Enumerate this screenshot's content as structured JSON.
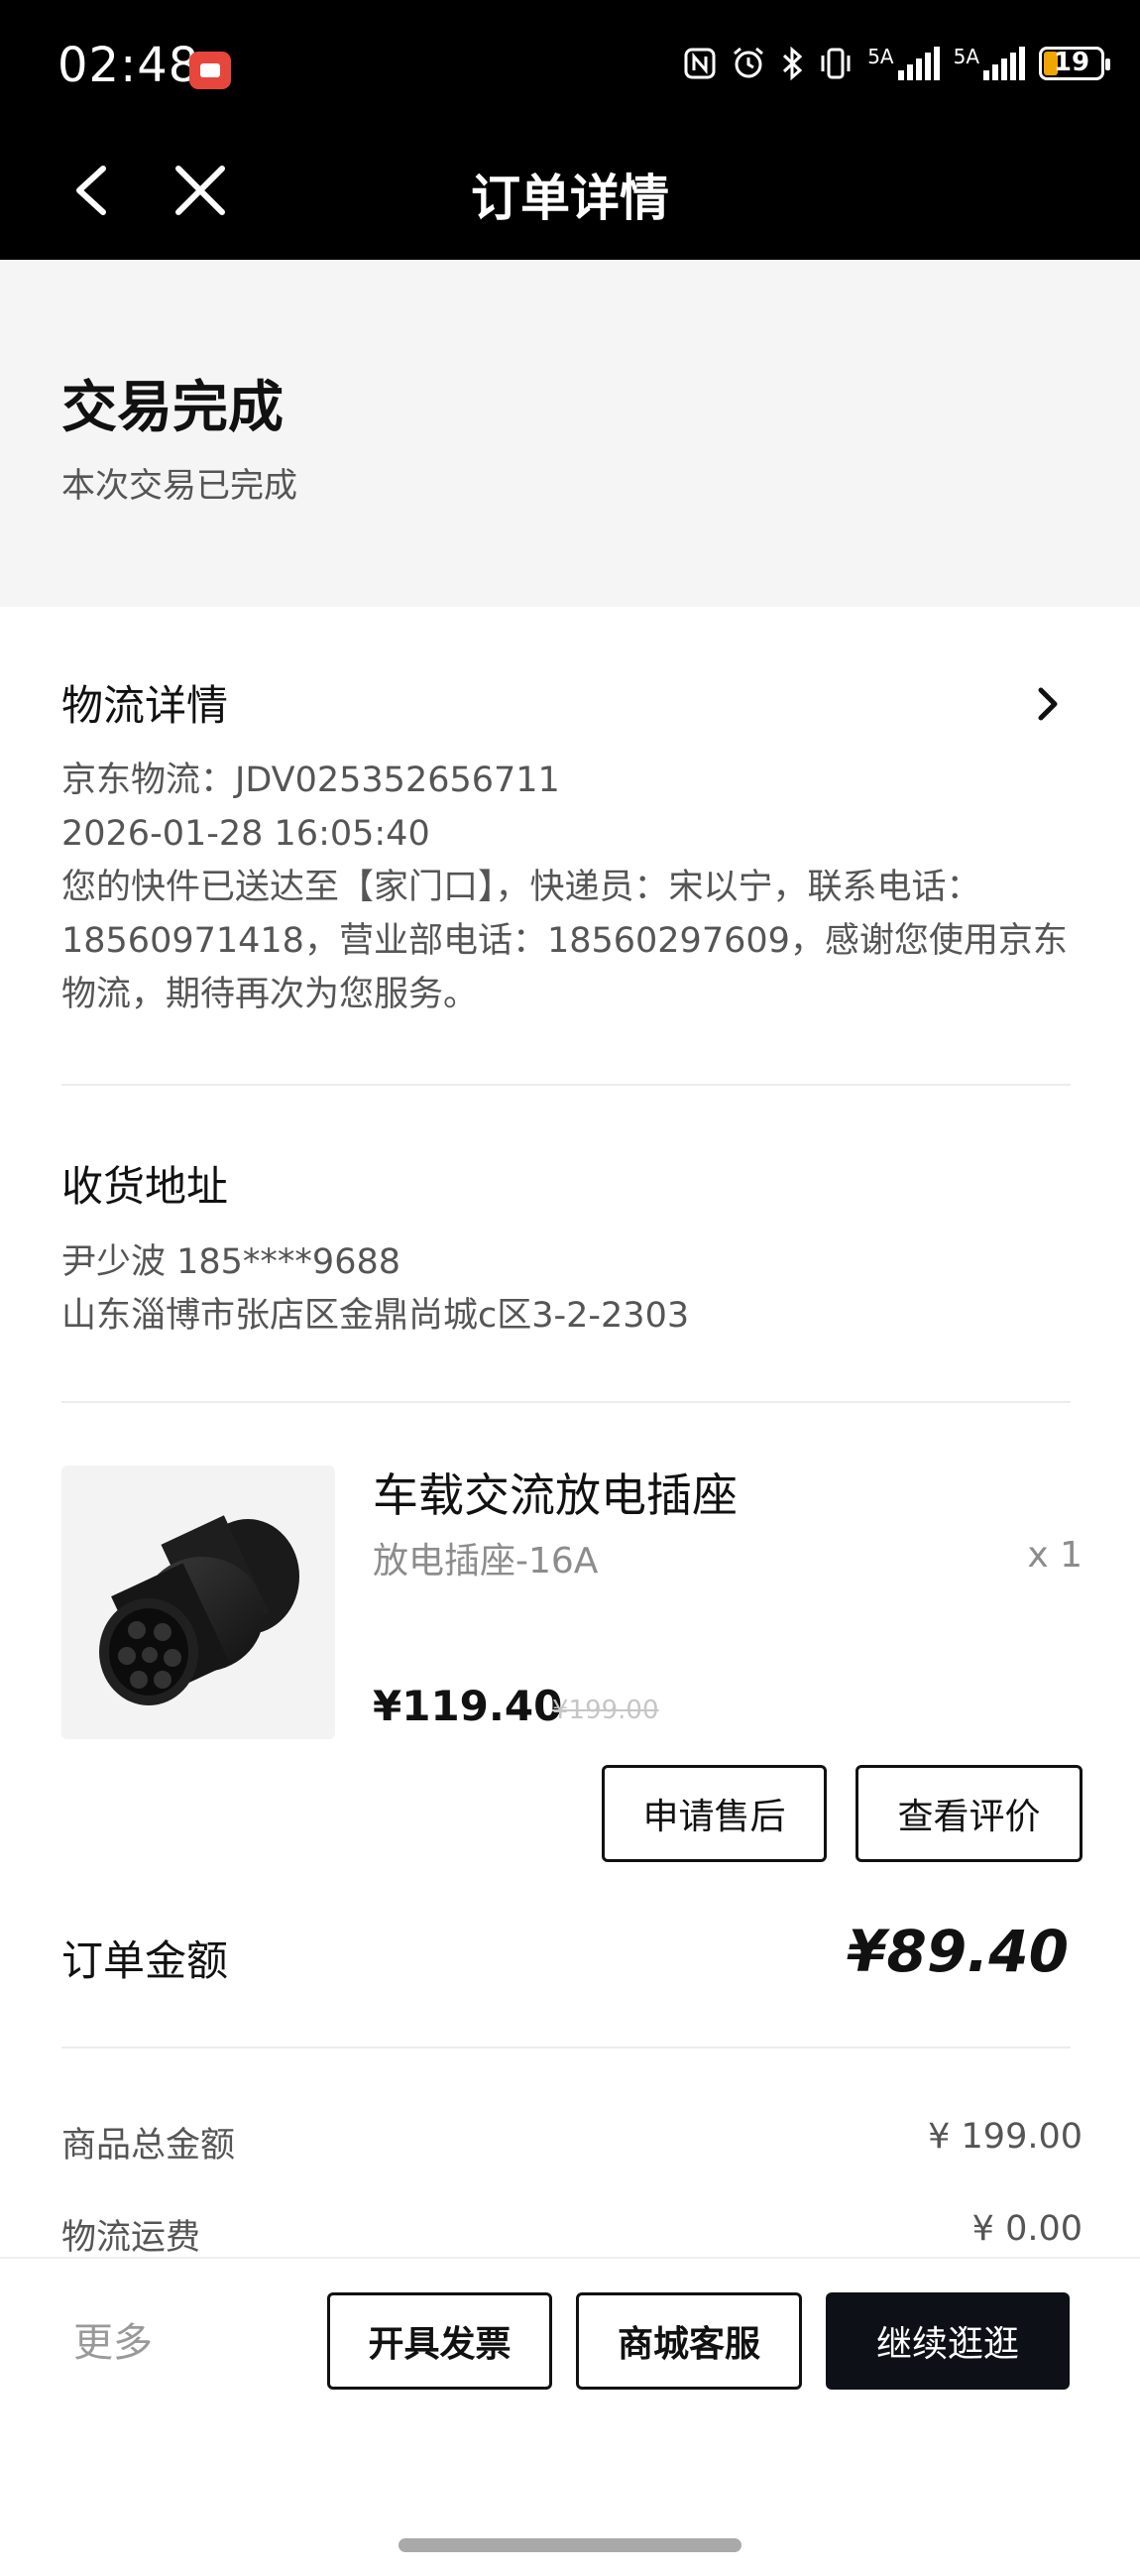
{
  "status_bar": {
    "time": "02:48",
    "signal1_label": "5A",
    "signal2_label": "5A",
    "battery": "19",
    "icons": [
      "nfc-icon",
      "alarm-icon",
      "bluetooth-icon",
      "vibrate-icon",
      "signal-icon",
      "signal-icon",
      "battery-icon"
    ]
  },
  "nav": {
    "title": "订单详情",
    "back_icon": "chevron-left-icon",
    "close_icon": "close-icon"
  },
  "status": {
    "title": "交易完成",
    "subtitle": "本次交易已完成"
  },
  "logistics": {
    "title": "物流详情",
    "tracking": "京东物流：JDV025352656711",
    "datetime": "2026-01-28 16:05:40",
    "message_lines": [
      "您的快件已送达至【家门口】，快递员：宋以宁，联系电话：",
      "18560971418，营业部电话：18560297609，感谢您使用京东",
      "物流，期待再次为您服务。"
    ]
  },
  "address": {
    "title": "收货地址",
    "recipient": "尹少波  185****9688",
    "address": "山东淄博市张店区金鼎尚城c区3-2-2303"
  },
  "product": {
    "name": "车载交流放电插座",
    "spec": "放电插座-16A",
    "qty": "x 1",
    "price": "¥119.40",
    "original_price": "¥199.00",
    "buttons": [
      "申请售后",
      "查看评价"
    ]
  },
  "order": {
    "total_label": "订单金额",
    "total_value": "¥89.40",
    "rows": [
      {
        "label": "商品总金额",
        "value": "¥ 199.00"
      },
      {
        "label": "物流运费",
        "value": "¥ 0.00"
      }
    ]
  },
  "bottom_bar": {
    "more": "更多",
    "invoice": "开具发票",
    "service": "商城客服",
    "continue": "继续逛逛"
  },
  "colors": {
    "accent": "#0d1117",
    "battery": "#f0a500",
    "status_bg": "#f5f5f5"
  }
}
